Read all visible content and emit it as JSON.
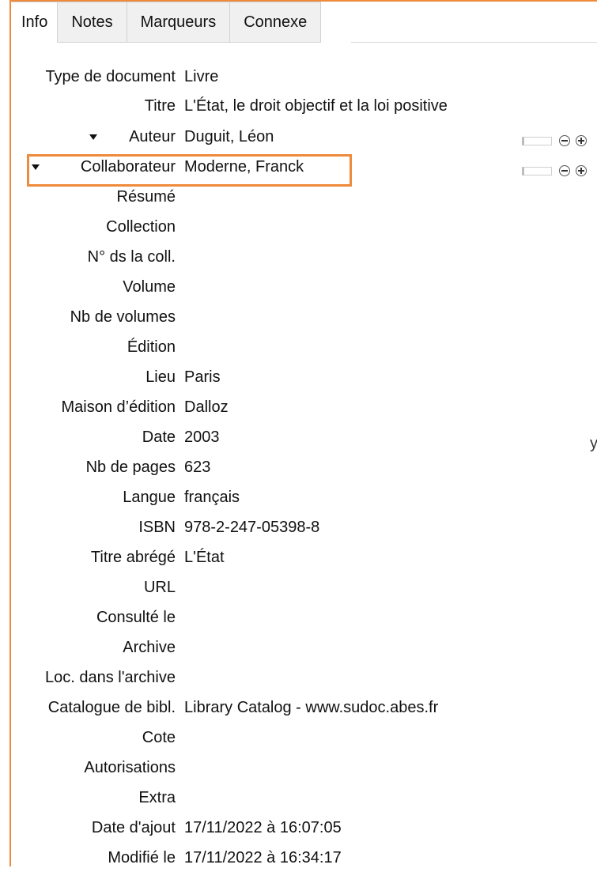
{
  "tabs": [
    "Info",
    "Notes",
    "Marqueurs",
    "Connexe"
  ],
  "fields": [
    {
      "label": "Type de document",
      "value": "Livre"
    },
    {
      "label": "Titre",
      "value": "L'État, le droit objectif et la loi positive"
    },
    {
      "label": "Auteur",
      "value": "Duguit, Léon"
    },
    {
      "label": "Collaborateur",
      "value": "Moderne, Franck"
    },
    {
      "label": "Résumé",
      "value": ""
    },
    {
      "label": "Collection",
      "value": ""
    },
    {
      "label": "N° ds la coll.",
      "value": ""
    },
    {
      "label": "Volume",
      "value": ""
    },
    {
      "label": "Nb de volumes",
      "value": ""
    },
    {
      "label": "Édition",
      "value": ""
    },
    {
      "label": "Lieu",
      "value": "Paris"
    },
    {
      "label": "Maison d’édition",
      "value": "Dalloz"
    },
    {
      "label": "Date",
      "value": "2003"
    },
    {
      "label": "Nb de pages",
      "value": "623"
    },
    {
      "label": "Langue",
      "value": "français"
    },
    {
      "label": "ISBN",
      "value": "978-2-247-05398-8"
    },
    {
      "label": "Titre abrégé",
      "value": "L'État"
    },
    {
      "label": "URL",
      "value": ""
    },
    {
      "label": "Consulté le",
      "value": ""
    },
    {
      "label": "Archive",
      "value": ""
    },
    {
      "label": "Loc. dans l'archive",
      "value": ""
    },
    {
      "label": "Catalogue de bibl.",
      "value": "Library Catalog - www.sudoc.abes.fr"
    },
    {
      "label": "Cote",
      "value": ""
    },
    {
      "label": "Autorisations",
      "value": ""
    },
    {
      "label": "Extra",
      "value": ""
    },
    {
      "label": "Date d'ajout",
      "value": "17/11/2022 à 16:07:05"
    },
    {
      "label": "Modifié le",
      "value": "17/11/2022 à 16:34:17"
    }
  ],
  "date_hint": "y",
  "colors": {
    "highlight": "#ED8A3C"
  }
}
